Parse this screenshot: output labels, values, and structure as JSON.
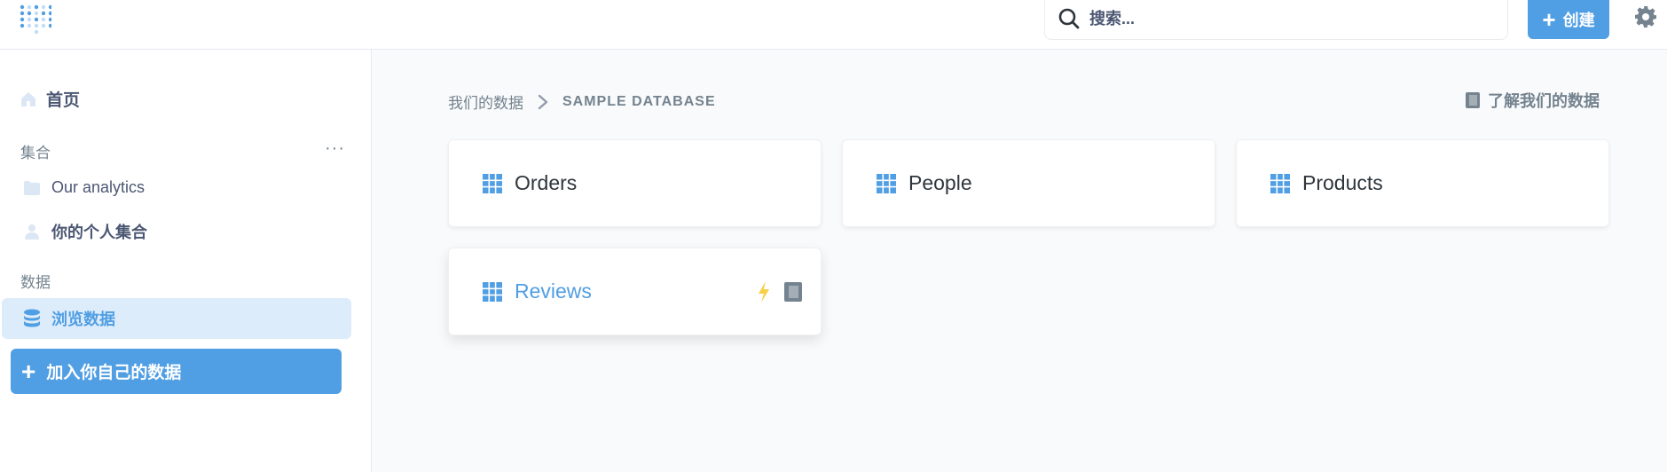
{
  "header": {
    "search_placeholder": "搜索...",
    "create_label": "创建",
    "icons": [
      "metabase-logo-icon",
      "search-icon",
      "plus-icon",
      "gear-icon"
    ]
  },
  "sidebar": {
    "home_label": "首页",
    "collections_label": "集合",
    "collections": [
      {
        "label": "Our analytics",
        "icon": "folder-icon"
      },
      {
        "label": "你的个人集合",
        "icon": "person-icon"
      }
    ],
    "data_label": "数据",
    "browse_label": "浏览数据",
    "add_data_label": "加入你自己的数据"
  },
  "main": {
    "breadcrumb": {
      "root": "我们的数据",
      "current": "SAMPLE DATABASE"
    },
    "learn_label": "了解我们的数据",
    "tables": [
      {
        "name": "Orders"
      },
      {
        "name": "People"
      },
      {
        "name": "Products"
      },
      {
        "name": "Reviews"
      }
    ]
  },
  "colors": {
    "brand": "#509ee3",
    "text": "#4c5773",
    "muted": "#74838f",
    "bolt": "#f9cf48"
  }
}
